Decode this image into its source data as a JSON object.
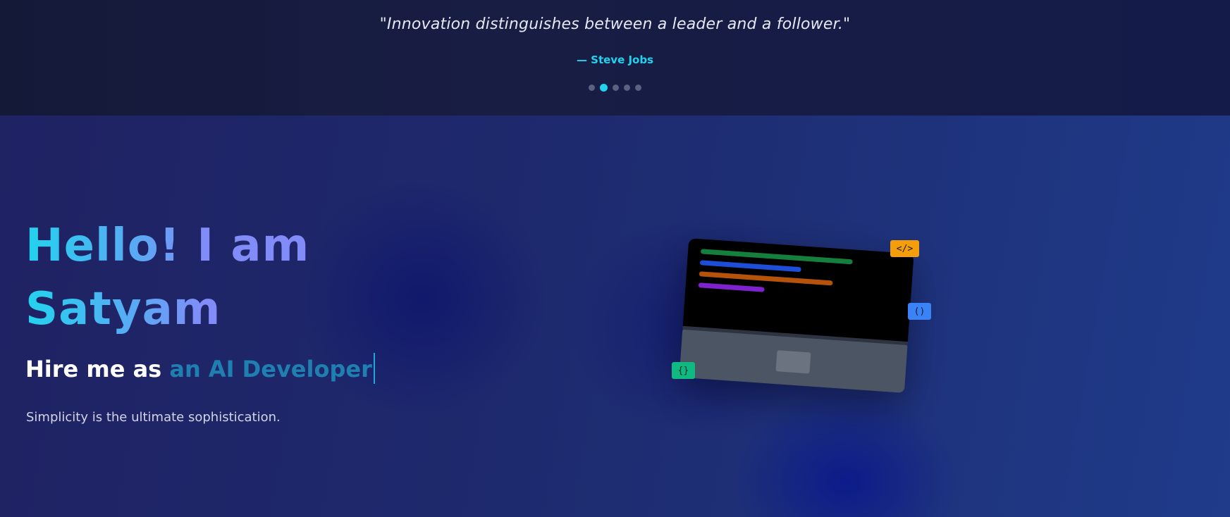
{
  "quote": {
    "text": "\"Innovation distinguishes between a leader and a follower.\"",
    "author": "— Steve Jobs",
    "slide_count": 5,
    "active_slide": 2
  },
  "hero": {
    "title": "Hello! I am Satyam",
    "hire_prefix": "Hire me as ",
    "hire_role": "an AI Developer",
    "tagline": "Simplicity is the ultimate sophistication."
  },
  "illustration": {
    "badges": {
      "html": "</>",
      "parens": "()",
      "braces": "{}"
    },
    "code_line_colors": [
      "#15803d",
      "#1d4ed8",
      "#b45309",
      "#7e22ce"
    ]
  },
  "colors": {
    "accent_cyan": "#22d3ee",
    "accent_indigo": "#818cf8",
    "badge_orange": "#f59e0b",
    "badge_blue": "#3b82f6",
    "badge_green": "#10b981"
  }
}
